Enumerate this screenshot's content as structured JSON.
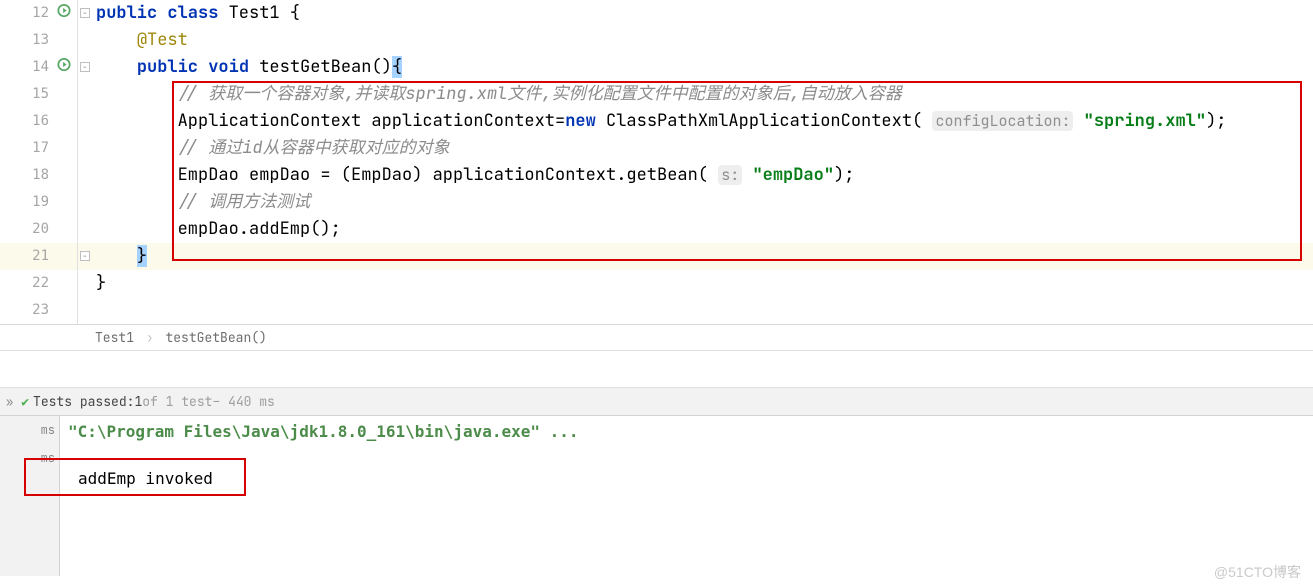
{
  "gutter": {
    "lines": [
      "12",
      "13",
      "14",
      "15",
      "16",
      "17",
      "18",
      "19",
      "20",
      "21",
      "22",
      "23"
    ]
  },
  "code": {
    "l12_kw1": "public",
    "l12_kw2": "class",
    "l12_cls": "Test1",
    "l12_brace": " {",
    "l13_annot": "@Test",
    "l14_kw1": "public",
    "l14_kw2": "void",
    "l14_method": "testGetBean",
    "l14_tail": "(){",
    "l15_comment": "// 获取一个容器对象,并读取spring.xml文件,实例化配置文件中配置的对象后,自动放入容器",
    "l16_a": "ApplicationContext applicationContext=",
    "l16_new": "new",
    "l16_b": " ClassPathXmlApplicationContext( ",
    "l16_hint": "configLocation:",
    "l16_c": " ",
    "l16_str": "\"spring.xml\"",
    "l16_d": ");",
    "l17_comment": "// 通过id从容器中获取对应的对象",
    "l18_a": "EmpDao empDao = (EmpDao) applicationContext.getBean( ",
    "l18_hint": "s:",
    "l18_b": " ",
    "l18_str": "\"empDao\"",
    "l18_c": ");",
    "l19_comment": "// 调用方法测试",
    "l20": "empDao.addEmp();",
    "l21": "}",
    "l22": "}"
  },
  "breadcrumb": {
    "item1": "Test1",
    "item2": "testGetBean()"
  },
  "test_status": {
    "prefix": "Tests passed: ",
    "count": "1",
    "mid": " of 1 test",
    "time": " – 440 ms"
  },
  "console": {
    "sidebar_items": [
      "ms",
      "ms"
    ],
    "cmd": "\"C:\\Program Files\\Java\\jdk1.8.0_161\\bin\\java.exe\" ...",
    "output": "addEmp invoked"
  },
  "watermark": "@51CTO博客"
}
